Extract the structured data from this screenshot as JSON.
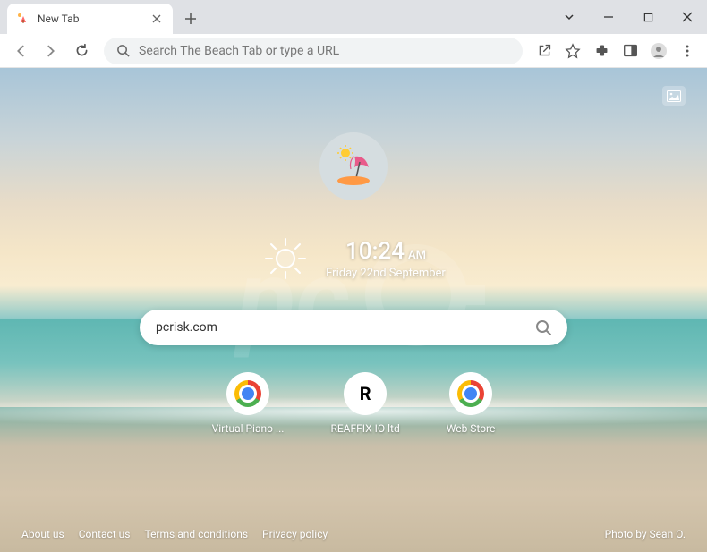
{
  "window": {
    "tab_title": "New Tab"
  },
  "addressbar": {
    "placeholder": "Search The Beach Tab or type a URL"
  },
  "page": {
    "time": "10:24",
    "ampm": "AM",
    "date": "Friday 22nd September",
    "search_value": "pcrisk.com",
    "shortcuts": [
      {
        "label": "Virtual Piano ...",
        "icon": "chrome"
      },
      {
        "label": "REAFFIX IO ltd",
        "icon": "R"
      },
      {
        "label": "Web Store",
        "icon": "chrome"
      }
    ],
    "footer_links": [
      "About us",
      "Contact us",
      "Terms and conditions",
      "Privacy policy"
    ],
    "photo_credit": "Photo by Sean O."
  }
}
